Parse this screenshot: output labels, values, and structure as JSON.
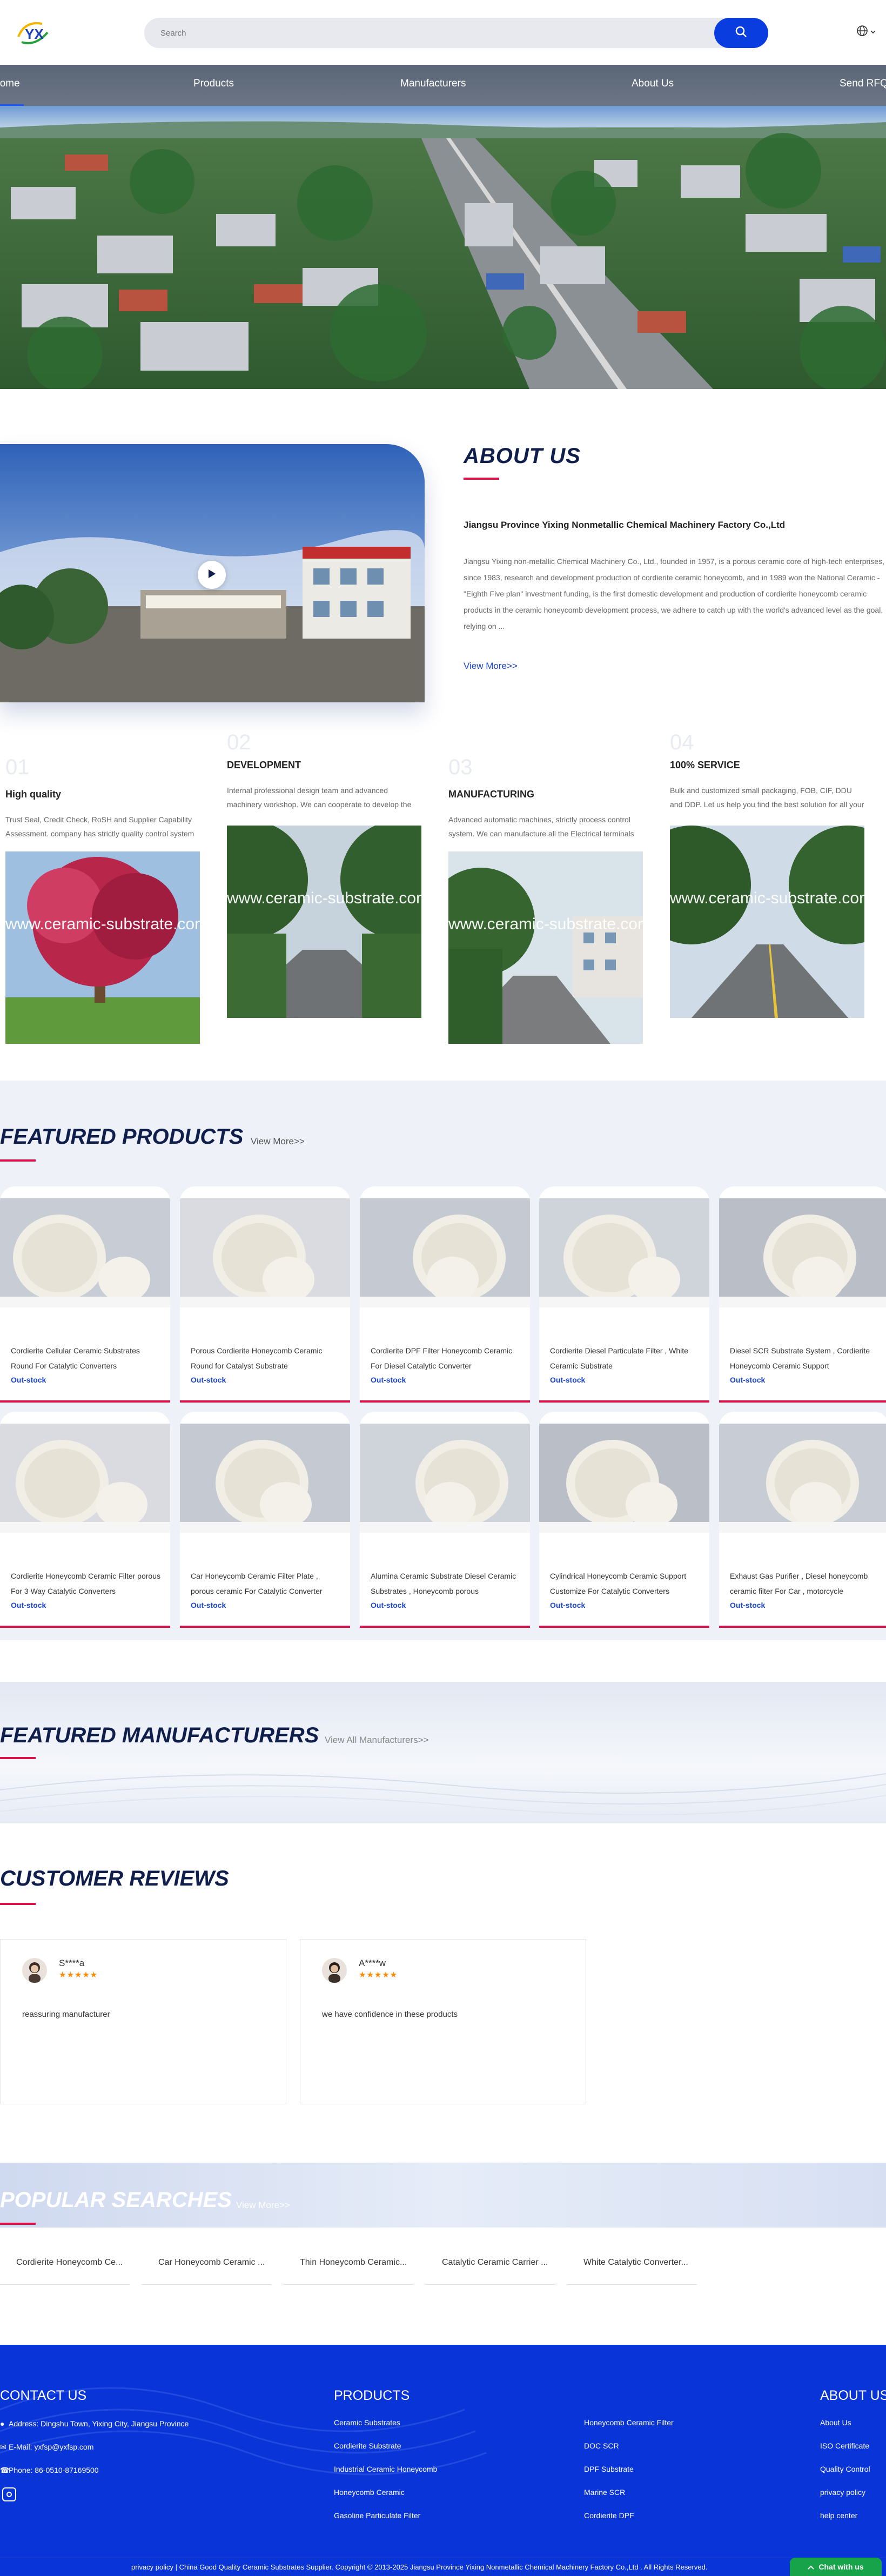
{
  "header": {
    "search_placeholder": "Search",
    "logo_text": "YX"
  },
  "nav": {
    "items": [
      "Home",
      "Products",
      "Manufacturers",
      "About Us",
      "Send RFQ"
    ]
  },
  "about": {
    "title": "ABOUT US",
    "company": "Jiangsu Province Yixing Nonmetallic Chemical Machinery Factory Co.,Ltd",
    "text": "Jiangsu Yixing non-metallic Chemical Machinery Co., Ltd., founded in 1957, is a porous ceramic core of high-tech enterprises, since 1983, research and development production of cordierite ceramic honeycomb, and in 1989 won the National Ceramic - \"Eighth Five plan\" investment funding, is the first domestic development and production of cordierite honeycomb ceramic products in the ceramic honeycomb development process, we adhere to catch up with the world's advanced level as the goal, relying on ...",
    "more": "View More>>",
    "features": [
      {
        "num": "01",
        "title": "High quality",
        "desc": "Trust Seal, Credit Check, RoSH and Supplier Capability Assessment. company has strictly quality control system and professional test lab."
      },
      {
        "num": "02",
        "title": "DEVELOPMENT",
        "desc": "Internal professional design team and advanced machinery workshop. We can cooperate to develop the products you need."
      },
      {
        "num": "03",
        "title": "MANUFACTURING",
        "desc": "Advanced automatic machines, strictly process control system. We can manufacture all the Electrical terminals beyond your demand."
      },
      {
        "num": "04",
        "title": "100% SERVICE",
        "desc": "Bulk and customized small packaging, FOB, CIF, DDU and DDP. Let us help you find the best solution for all your concerns."
      }
    ],
    "watermark": "www.ceramic-substrate.com"
  },
  "featured_products": {
    "title": "FEATURED PRODUCTS",
    "more": "View More>>",
    "items": [
      {
        "name": "Cordierite Cellular Ceramic Substrates Round For Catalytic Converters",
        "stock": "Out-stock"
      },
      {
        "name": "Porous Cordierite Honeycomb Ceramic Round for Catalyst Substrate",
        "stock": "Out-stock"
      },
      {
        "name": "Cordierite DPF Filter Honeycomb Ceramic For Diesel Catalytic Converter",
        "stock": "Out-stock"
      },
      {
        "name": "Cordierite Diesel Particulate Filter , White Ceramic Substrate",
        "stock": "Out-stock"
      },
      {
        "name": "Diesel SCR Substrate System , Cordierite Honeycomb Ceramic Support",
        "stock": "Out-stock"
      },
      {
        "name": "Cordierite Honeycomb Ceramic Filter porous For 3 Way Catalytic Converters",
        "stock": "Out-stock"
      },
      {
        "name": "Car Honeycomb Ceramic Filter Plate , porous ceramic For Catalytic Converter",
        "stock": "Out-stock"
      },
      {
        "name": "Alumina Ceramic Substrate Diesel Ceramic Substrates , Honeycomb porous",
        "stock": "Out-stock"
      },
      {
        "name": "Cylindrical Honeycomb Ceramic Support Customize For Catalytic Converters",
        "stock": "Out-stock"
      },
      {
        "name": "Exhaust Gas Purifier , Diesel honeycomb ceramic filter For Car , motorcycle",
        "stock": "Out-stock"
      }
    ]
  },
  "featured_manufacturers": {
    "title": "FEATURED MANUFACTURERS",
    "more": "View All Manufacturers>>"
  },
  "reviews": {
    "title": "CUSTOMER REVIEWS",
    "items": [
      {
        "name": "S****a",
        "stars": "★★★★★",
        "text": "reassuring manufacturer"
      },
      {
        "name": "A****w",
        "stars": "★★★★★",
        "text": "we have confidence in these products"
      }
    ]
  },
  "popular_searches": {
    "title": "POPULAR SEARCHES",
    "more": "View More>>",
    "items": [
      "Cordierite Honeycomb Ce...",
      "Car Honeycomb Ceramic ...",
      "Thin Honeycomb Ceramic...",
      "Catalytic Ceramic Carrier ...",
      "White Catalytic Converter..."
    ]
  },
  "footer": {
    "contact": {
      "title": "CONTACT US",
      "address": "Address: Dingshu Town, Yixing City, Jiangsu Province",
      "email": "E-Mail: yxfsp@yxfsp.com",
      "phone": "Phone: 86-0510-87169500"
    },
    "products": {
      "title": "PRODUCTS",
      "col1": [
        "Ceramic Substrates",
        "Cordierite Substrate",
        "Industrial Ceramic Honeycomb",
        "Honeycomb Ceramic",
        "Gasoline Particulate Filter"
      ],
      "col2": [
        "Honeycomb Ceramic Filter",
        "DOC SCR",
        "DPF Substrate",
        "Marine SCR",
        "Cordierite DPF"
      ]
    },
    "about": {
      "title": "ABOUT US",
      "items": [
        "About Us",
        "ISO Certificate",
        "Quality Control",
        "privacy policy",
        "help center"
      ]
    },
    "copyright": "privacy policy | China Good Quality Ceramic Substrates Supplier. Copyright © 2013-2025 Jiangsu Province Yixing Nonmetallic Chemical Machinery Factory Co.,Ltd . All Rights Reserved.",
    "chat": "Chat with us"
  },
  "colors": {
    "brand_blue": "#0934d8",
    "accent_red": "#d8134a",
    "stock_blue": "#1d46c8",
    "chat_green": "#16a34a"
  }
}
